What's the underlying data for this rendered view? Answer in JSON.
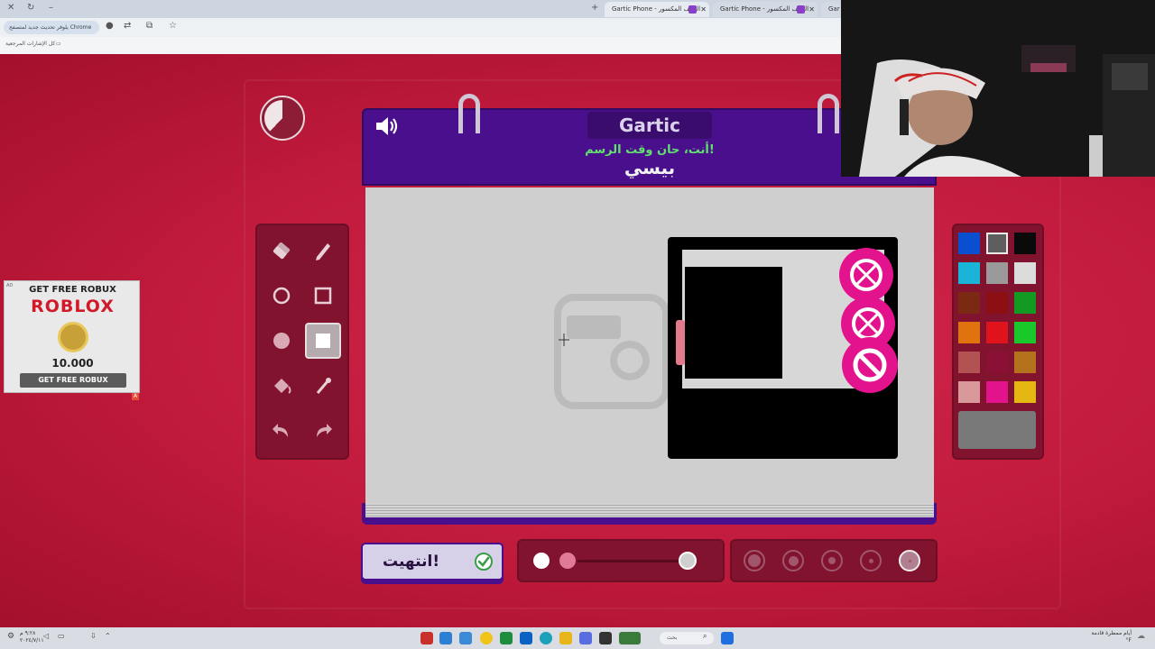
{
  "browser": {
    "tabs": [
      {
        "label": "Gartic Phone - الهاتف المكسور"
      },
      {
        "label": "Gartic Phone - الهاتف المكسور"
      },
      {
        "label": "Gar"
      }
    ],
    "update_button": "يلوفر تحديث جديد لمتصفح Chrome",
    "bookmarks_label": "كل الإشارات المرجعية"
  },
  "game": {
    "logo": "Gartic",
    "prompt": "أنت، حان وقت الرسم!",
    "word": "بيسي",
    "timer_remaining_fraction": 0.38,
    "done_label": "انتهيت!",
    "tools": [
      {
        "name": "eraser-tool",
        "icon": "eraser-icon"
      },
      {
        "name": "pencil-tool",
        "icon": "pencil-icon"
      },
      {
        "name": "ellipse-outline-tool",
        "icon": "circle-outline-icon"
      },
      {
        "name": "rect-outline-tool",
        "icon": "square-outline-icon"
      },
      {
        "name": "ellipse-fill-tool",
        "icon": "circle-filled-icon"
      },
      {
        "name": "rect-fill-tool",
        "icon": "square-filled-icon",
        "selected": true
      },
      {
        "name": "bucket-tool",
        "icon": "paint-bucket-icon"
      },
      {
        "name": "eyedropper-tool",
        "icon": "eyedropper-icon"
      },
      {
        "name": "undo-tool",
        "icon": "undo-icon"
      },
      {
        "name": "redo-tool",
        "icon": "redo-icon"
      }
    ],
    "palette": [
      "#0a4fcf",
      "#5e5e5e",
      "#0a0a0a",
      "#1ab4d8",
      "#9a9a9a",
      "#dcdcdc",
      "#7a2a12",
      "#8c0f14",
      "#139a23",
      "#e0730d",
      "#e0121c",
      "#1bc82a",
      "#b35252",
      "#8a1036",
      "#b5721c",
      "#d9999a",
      "#e3138e",
      "#e5b713"
    ],
    "selected_color": "#797979",
    "opacity_fraction": 1.0,
    "size_options": 5,
    "selected_size_index": 4
  },
  "ad": {
    "title": "GET FREE ROBUX",
    "brand": "ROBLOX",
    "amount": "10.000",
    "button": "GET FREE ROBUX",
    "badge": "AD",
    "corner": "A"
  },
  "taskbar": {
    "search": "بحث",
    "weather_line1": "أيام ممطرة قادمة",
    "weather_line2": "°F"
  }
}
